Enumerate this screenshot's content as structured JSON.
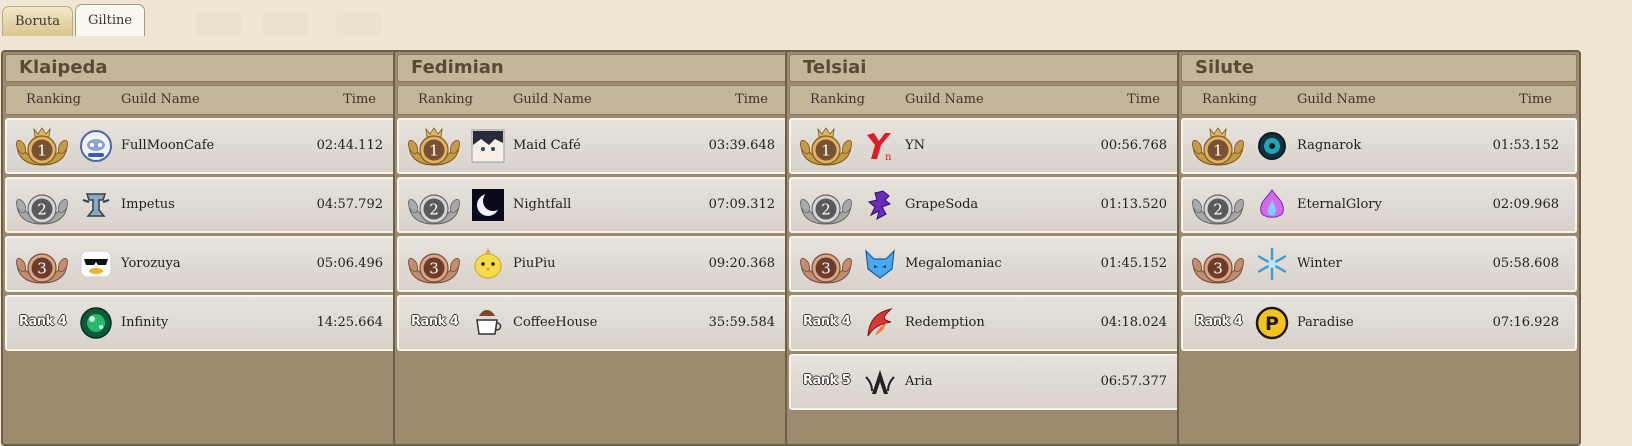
{
  "tabs": [
    {
      "label": "Boruta",
      "active": false
    },
    {
      "label": "Giltine",
      "active": true
    }
  ],
  "columns": {
    "ranking": "Ranking",
    "guild_name": "Guild Name",
    "time": "Time"
  },
  "panels": [
    {
      "title": "Klaipeda",
      "rows": [
        {
          "rank": "1",
          "guild": "FullMoonCafe",
          "time": "02:44.112",
          "emblem": "ghost-face-emblem-icon"
        },
        {
          "rank": "2",
          "guild": "Impetus",
          "time": "04:57.792",
          "emblem": "chess-tower-emblem-icon"
        },
        {
          "rank": "3",
          "guild": "Yorozuya",
          "time": "05:06.496",
          "emblem": "sunglasses-duck-emblem-icon"
        },
        {
          "rank": "Rank 4",
          "guild": "Infinity",
          "time": "14:25.664",
          "emblem": "green-orb-emblem-icon"
        }
      ]
    },
    {
      "title": "Fedimian",
      "rows": [
        {
          "rank": "1",
          "guild": "Maid Café",
          "time": "03:39.648",
          "emblem": "anime-face-emblem-icon"
        },
        {
          "rank": "2",
          "guild": "Nightfall",
          "time": "07:09.312",
          "emblem": "crescent-moon-emblem-icon"
        },
        {
          "rank": "3",
          "guild": "PiuPiu",
          "time": "09:20.368",
          "emblem": "yellow-chick-emblem-icon"
        },
        {
          "rank": "Rank 4",
          "guild": "CoffeeHouse",
          "time": "35:59.584",
          "emblem": "coffee-cup-emblem-icon"
        }
      ]
    },
    {
      "title": "Telsiai",
      "rows": [
        {
          "rank": "1",
          "guild": "YN",
          "time": "00:56.768",
          "emblem": "red-yn-emblem-icon"
        },
        {
          "rank": "2",
          "guild": "GrapeSoda",
          "time": "01:13.520",
          "emblem": "purple-dragon-emblem-icon"
        },
        {
          "rank": "3",
          "guild": "Megalomaniac",
          "time": "01:45.152",
          "emblem": "blue-fox-emblem-icon"
        },
        {
          "rank": "Rank 4",
          "guild": "Redemption",
          "time": "04:18.024",
          "emblem": "red-wing-emblem-icon"
        },
        {
          "rank": "Rank 5",
          "guild": "Aria",
          "time": "06:57.377",
          "emblem": "a-wings-emblem-icon"
        }
      ]
    },
    {
      "title": "Silute",
      "rows": [
        {
          "rank": "1",
          "guild": "Ragnarok",
          "time": "01:53.152",
          "emblem": "teal-gear-emblem-icon"
        },
        {
          "rank": "2",
          "guild": "EternalGlory",
          "time": "02:09.968",
          "emblem": "pink-flame-emblem-icon"
        },
        {
          "rank": "3",
          "guild": "Winter",
          "time": "05:58.608",
          "emblem": "snowflake-emblem-icon"
        },
        {
          "rank": "Rank 4",
          "guild": "Paradise",
          "time": "07:16.928",
          "emblem": "gold-p-emblem-icon"
        }
      ]
    }
  ]
}
